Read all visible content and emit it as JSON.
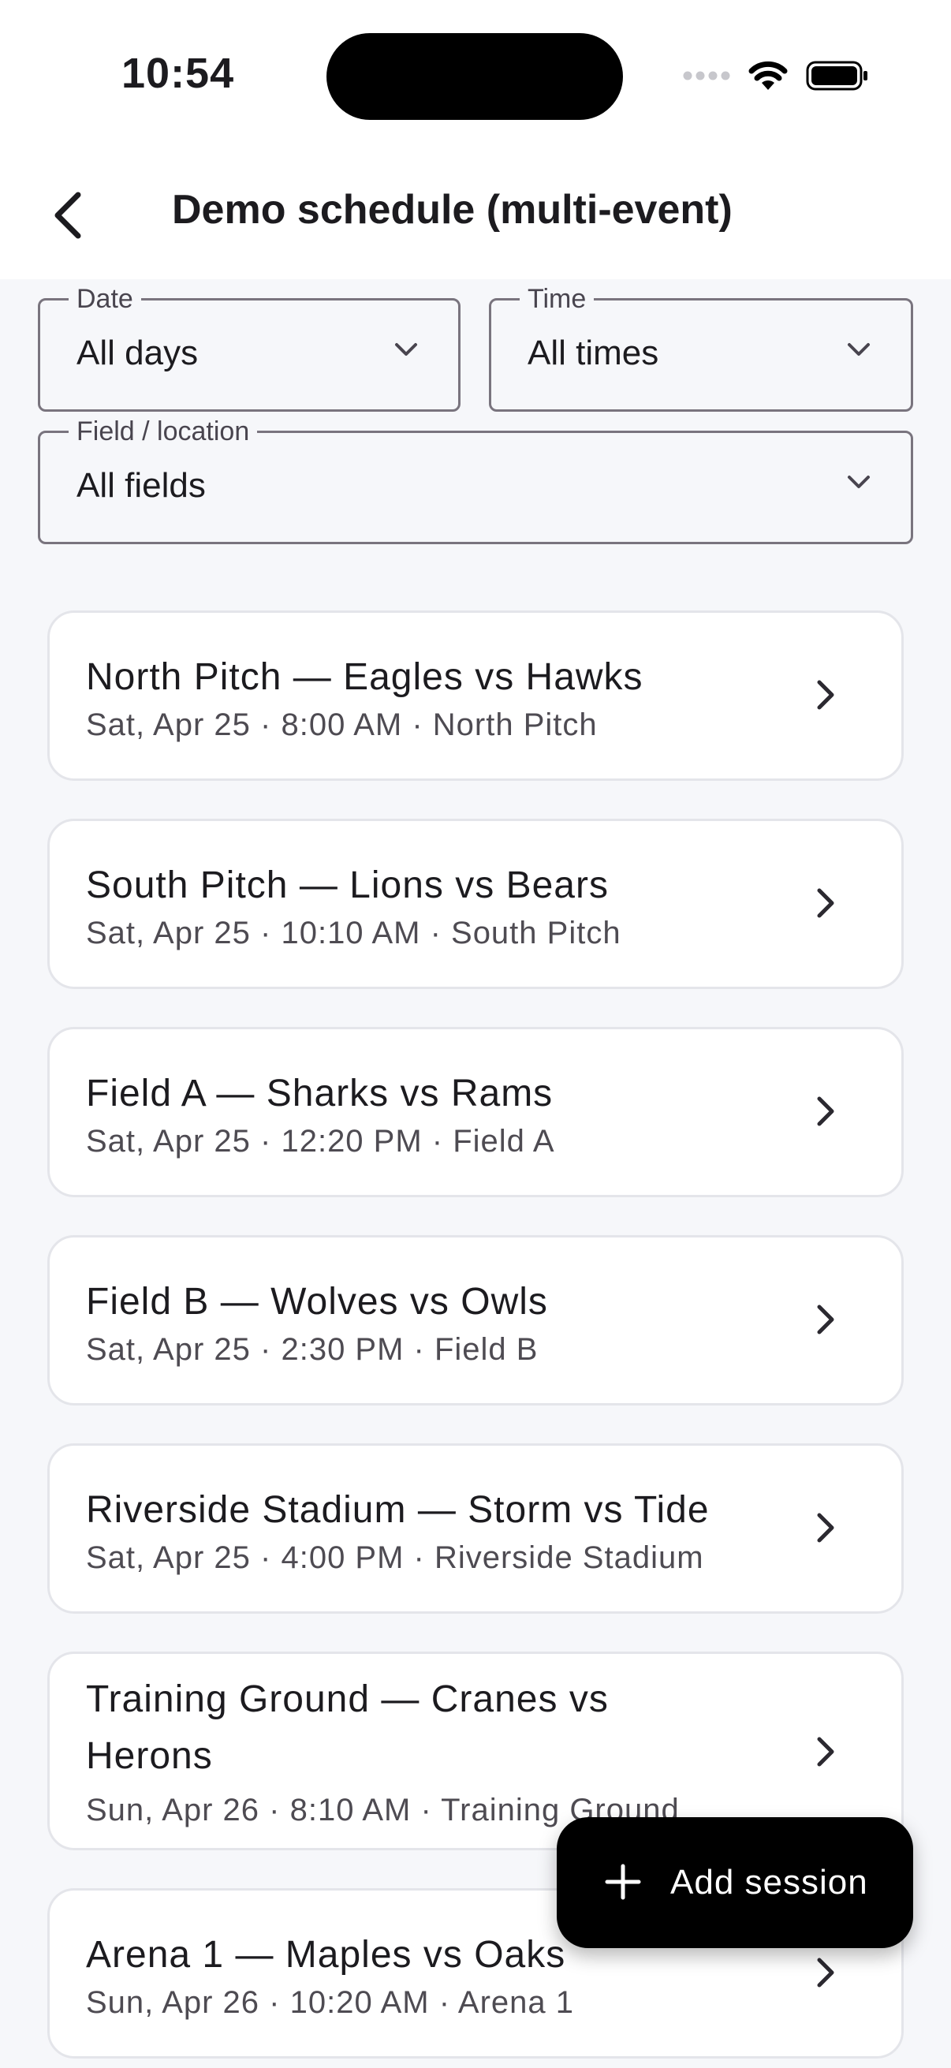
{
  "status_bar": {
    "time": "10:54"
  },
  "header": {
    "title": "Demo schedule (multi-event)"
  },
  "filters": {
    "date": {
      "label": "Date",
      "value": "All days"
    },
    "time": {
      "label": "Time",
      "value": "All times"
    },
    "field": {
      "label": "Field / location",
      "value": "All fields"
    }
  },
  "sessions": [
    {
      "title": "North Pitch — Eagles vs Hawks",
      "subtitle": "Sat, Apr 25 · 8:00 AM · North Pitch"
    },
    {
      "title": "South Pitch — Lions vs Bears",
      "subtitle": "Sat, Apr 25 · 10:10 AM · South Pitch"
    },
    {
      "title": "Field A — Sharks vs Rams",
      "subtitle": "Sat, Apr 25 · 12:20 PM · Field A"
    },
    {
      "title": "Field B — Wolves vs Owls",
      "subtitle": "Sat, Apr 25 · 2:30 PM · Field B"
    },
    {
      "title": "Riverside Stadium — Storm vs Tide",
      "subtitle": "Sat, Apr 25 · 4:00 PM · Riverside Stadium"
    },
    {
      "title": "Training Ground — Cranes vs Herons",
      "subtitle": "Sun, Apr 26 · 8:10 AM · Training Ground"
    },
    {
      "title": "Arena 1 — Maples vs Oaks",
      "subtitle": "Sun, Apr 26 · 10:20 AM · Arena 1"
    }
  ],
  "fab": {
    "label": "Add session"
  }
}
